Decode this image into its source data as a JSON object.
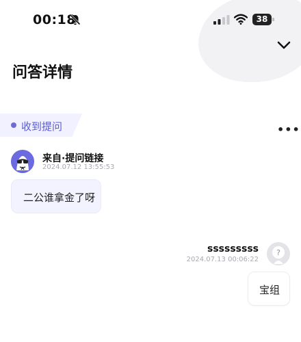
{
  "status_bar": {
    "time": "00:18",
    "battery": "38",
    "icons": [
      "bell-muted-icon",
      "signal-icon",
      "wifi-icon",
      "battery-icon"
    ]
  },
  "header": {
    "title": "问答详情",
    "collapse_icon": "chevron-down-icon"
  },
  "section": {
    "tag_label": "收到提问",
    "more_icon": "more-horizontal-icon"
  },
  "messages": [
    {
      "sender": "来自·提问链接",
      "timestamp": "2024.07.12 13:55:53",
      "text": "二公谁拿金了呀",
      "avatar": "sunglasses-avatar"
    },
    {
      "sender": "sssssssss",
      "timestamp": "2024.07.13 00:06:22",
      "text": "宝组",
      "avatar": "question-avatar"
    }
  ],
  "colors": {
    "accent": "#5b5bd0",
    "tag_bg": "#f1f1ff",
    "bubble_bg": "#f3f3ff",
    "timestamp": "#a9a9b3"
  }
}
